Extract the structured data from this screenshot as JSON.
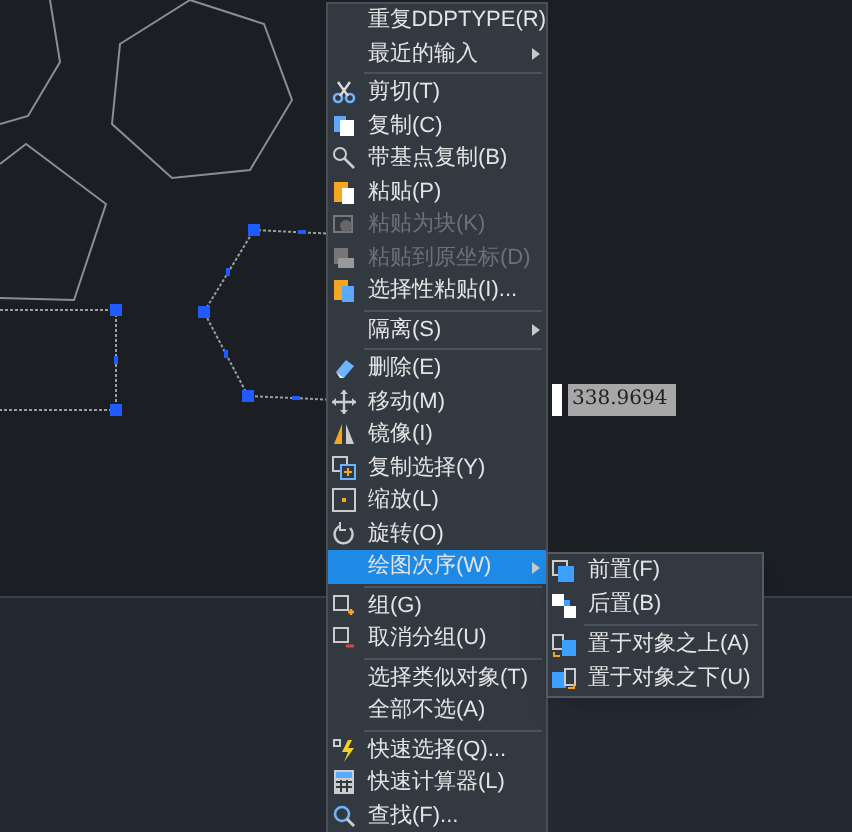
{
  "context_menu": {
    "items": [
      {
        "kind": "item",
        "label": "重复DDPTYPE(R)",
        "disabled": false,
        "submenu": false,
        "selected": false
      },
      {
        "kind": "item",
        "label": "最近的输入",
        "disabled": false,
        "submenu": true,
        "selected": false
      },
      {
        "kind": "separator"
      },
      {
        "kind": "item",
        "label": "剪切(T)",
        "disabled": false,
        "submenu": false,
        "selected": false
      },
      {
        "kind": "item",
        "label": "复制(C)",
        "disabled": false,
        "submenu": false,
        "selected": false
      },
      {
        "kind": "item",
        "label": "带基点复制(B)",
        "disabled": false,
        "submenu": false,
        "selected": false
      },
      {
        "kind": "item",
        "label": "粘贴(P)",
        "disabled": false,
        "submenu": false,
        "selected": false
      },
      {
        "kind": "item",
        "label": "粘贴为块(K)",
        "disabled": true,
        "submenu": false,
        "selected": false
      },
      {
        "kind": "item",
        "label": "粘贴到原坐标(D)",
        "disabled": true,
        "submenu": false,
        "selected": false
      },
      {
        "kind": "item",
        "label": "选择性粘贴(I)...",
        "disabled": false,
        "submenu": false,
        "selected": false
      },
      {
        "kind": "separator"
      },
      {
        "kind": "item",
        "label": "隔离(S)",
        "disabled": false,
        "submenu": true,
        "selected": false
      },
      {
        "kind": "separator"
      },
      {
        "kind": "item",
        "label": "删除(E)",
        "disabled": false,
        "submenu": false,
        "selected": false
      },
      {
        "kind": "item",
        "label": "移动(M)",
        "disabled": false,
        "submenu": false,
        "selected": false
      },
      {
        "kind": "item",
        "label": "镜像(I)",
        "disabled": false,
        "submenu": false,
        "selected": false
      },
      {
        "kind": "item",
        "label": "复制选择(Y)",
        "disabled": false,
        "submenu": false,
        "selected": false
      },
      {
        "kind": "item",
        "label": "缩放(L)",
        "disabled": false,
        "submenu": false,
        "selected": false
      },
      {
        "kind": "item",
        "label": "旋转(O)",
        "disabled": false,
        "submenu": false,
        "selected": false
      },
      {
        "kind": "item",
        "label": "绘图次序(W)",
        "disabled": false,
        "submenu": true,
        "selected": true
      },
      {
        "kind": "separator"
      },
      {
        "kind": "item",
        "label": "组(G)",
        "disabled": false,
        "submenu": false,
        "selected": false
      },
      {
        "kind": "item",
        "label": "取消分组(U)",
        "disabled": false,
        "submenu": false,
        "selected": false
      },
      {
        "kind": "separator"
      },
      {
        "kind": "item",
        "label": "选择类似对象(T)",
        "disabled": false,
        "submenu": false,
        "selected": false
      },
      {
        "kind": "item",
        "label": "全部不选(A)",
        "disabled": false,
        "submenu": false,
        "selected": false
      },
      {
        "kind": "separator"
      },
      {
        "kind": "item",
        "label": "快速选择(Q)...",
        "disabled": false,
        "submenu": false,
        "selected": false
      },
      {
        "kind": "item",
        "label": "快速计算器(L)",
        "disabled": false,
        "submenu": false,
        "selected": false
      },
      {
        "kind": "item",
        "label": "查找(F)...",
        "disabled": false,
        "submenu": false,
        "selected": false
      }
    ]
  },
  "submenu": {
    "items": [
      {
        "kind": "item",
        "label": "前置(F)"
      },
      {
        "kind": "item",
        "label": "后置(B)"
      },
      {
        "kind": "separator"
      },
      {
        "kind": "item",
        "label": "置于对象之上(A)"
      },
      {
        "kind": "item",
        "label": "置于对象之下(U)"
      }
    ]
  },
  "dynamic_input": {
    "value": "338.9694"
  }
}
